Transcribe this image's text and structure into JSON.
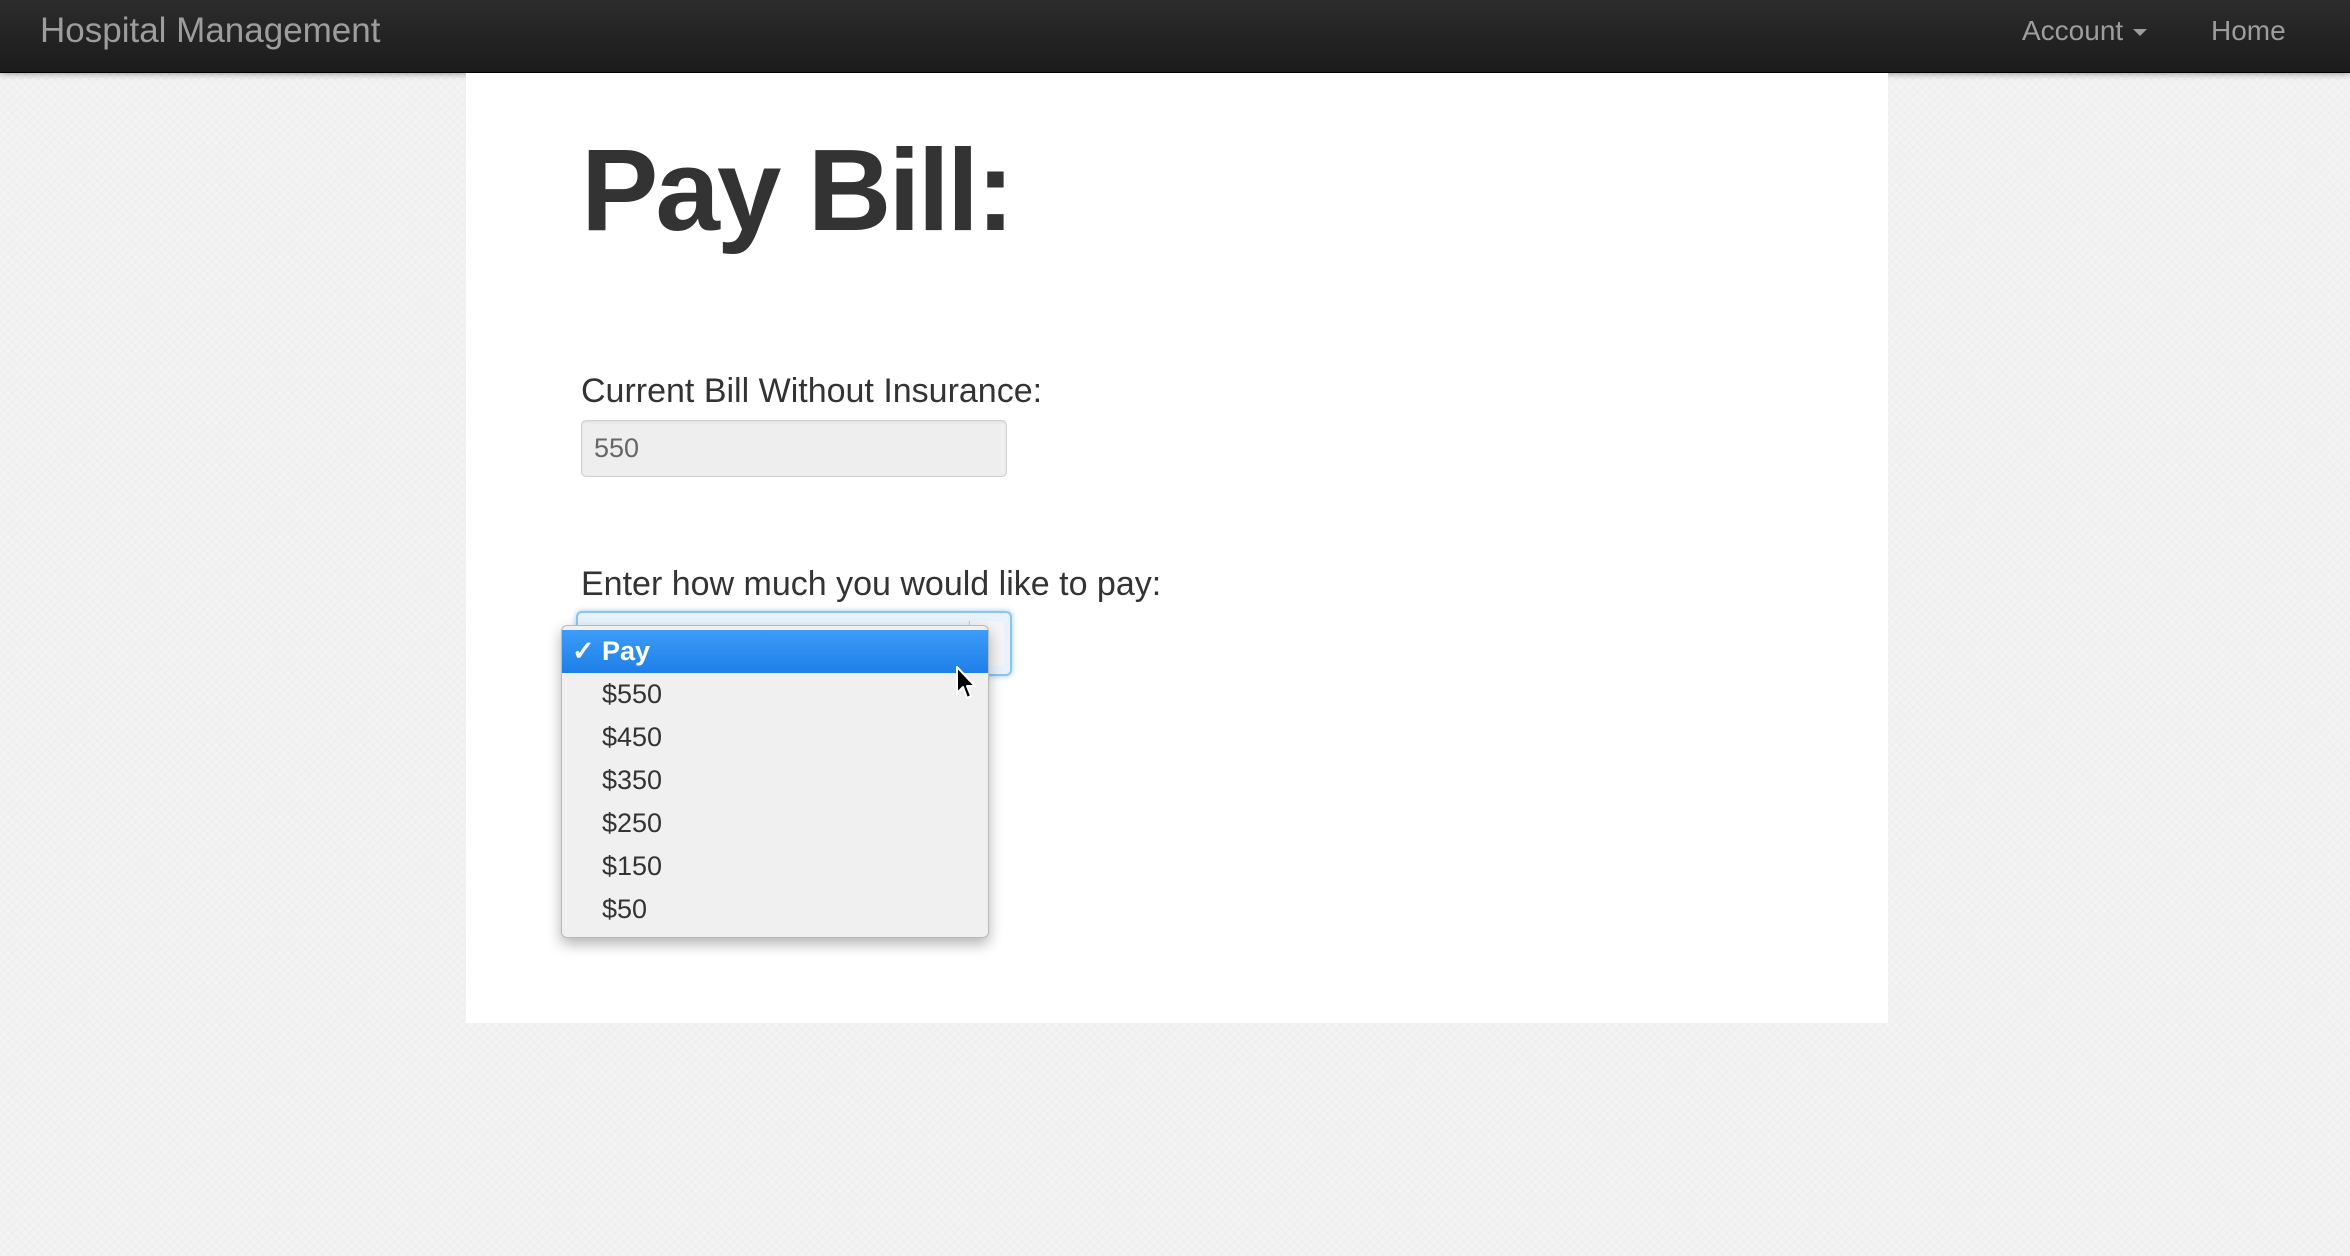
{
  "navbar": {
    "brand": "Hospital Management",
    "account_label": "Account",
    "home_label": "Home"
  },
  "page": {
    "title": "Pay Bill:"
  },
  "form": {
    "bill_label": "Current Bill Without Insurance:",
    "bill_value": "550",
    "pay_label": "Enter how much you would like to pay:",
    "pay_selected": "Pay",
    "pay_options": [
      "Pay",
      "$550",
      "$450",
      "$350",
      "$250",
      "$150",
      "$50"
    ],
    "check_glyph": "✓"
  },
  "icons": {
    "account_dropdown": "chevron-down-icon",
    "selected_option": "check-icon",
    "cursor": "mouse-pointer-icon"
  },
  "colors": {
    "navbar": "#1b1b1b",
    "selected_option": "#2a8cf0",
    "page_background": "#f3f3f3"
  }
}
